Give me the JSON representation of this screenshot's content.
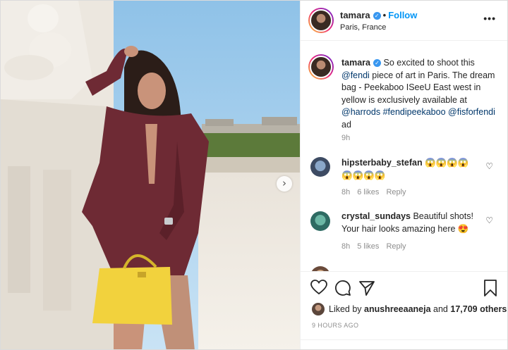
{
  "header": {
    "username": "tamara",
    "follow_label": "Follow",
    "location": "Paris, France",
    "more": "•••"
  },
  "caption": {
    "username": "tamara",
    "text_1": "So excited to shoot this",
    "mention_fendi": "@fendi",
    "text_2": "piece of art in Paris. The dream bag - Peekaboo ISeeU East west in yellow is exclusively available at",
    "mention_harrods": "@harrods",
    "hashtag": "#fendipeekaboo",
    "mention_fisforfendi": "@fisforfendi",
    "text_3": "ad",
    "time": "9h"
  },
  "comments": [
    {
      "username": "hipsterbaby_stefan",
      "text": "😱😱😱😱😱😱😱😱",
      "time": "8h",
      "likes": "6 likes",
      "reply": "Reply"
    },
    {
      "username": "crystal_sundays",
      "text": "Beautiful shots! Your hair looks amazing here 😍",
      "time": "8h",
      "likes": "5 likes",
      "reply": "Reply"
    }
  ],
  "likes": {
    "prefix": "Liked by",
    "user": "anushreeaaneja",
    "conjunction": "and",
    "others": "17,709 others"
  },
  "timestamp": "9 HOURS AGO",
  "colors": {
    "accent": "#0095f6",
    "verified": "#3897f0",
    "suit": "#6e2a34",
    "bag": "#f2d23d"
  },
  "icons": [
    "heart-icon",
    "comment-icon",
    "share-icon",
    "bookmark-icon",
    "verified-icon",
    "more-icon",
    "next-arrow-icon"
  ]
}
